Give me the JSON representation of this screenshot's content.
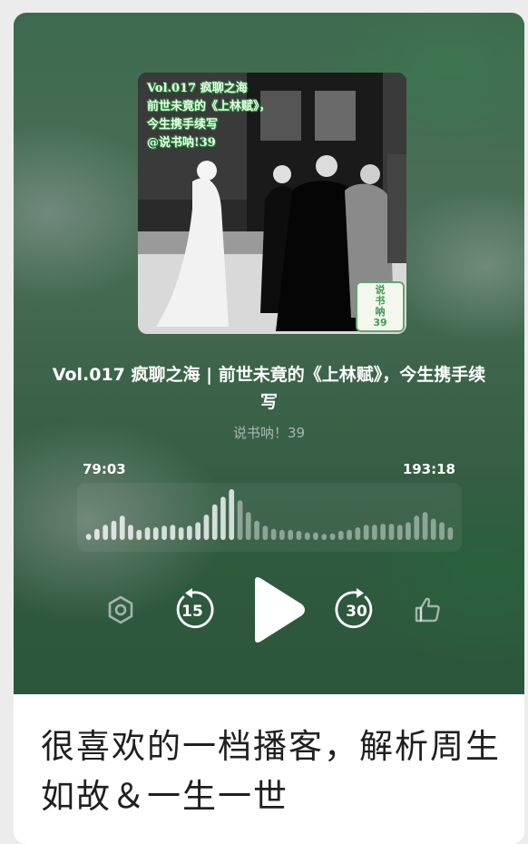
{
  "cover": {
    "overlay_lines": [
      "Vol.017  疯聊之海",
      "前世未竟的《上林赋》，",
      "今生携手续写",
      "@说书呐!39"
    ],
    "badge_lines": [
      "说",
      "书",
      "呐",
      "39"
    ]
  },
  "episode": {
    "title": "Vol.017 疯聊之海 | 前世未竟的《上林赋》，今生携手续写",
    "author": "说书呐！39"
  },
  "player": {
    "current_time": "79:03",
    "total_time": "193:18",
    "progress": 0.409,
    "waveform_levels": [
      0.12,
      0.22,
      0.3,
      0.38,
      0.48,
      0.3,
      0.2,
      0.25,
      0.25,
      0.28,
      0.3,
      0.25,
      0.28,
      0.35,
      0.5,
      0.7,
      0.85,
      1.0,
      0.78,
      0.55,
      0.38,
      0.28,
      0.22,
      0.2,
      0.2,
      0.18,
      0.15,
      0.15,
      0.12,
      0.13,
      0.18,
      0.2,
      0.25,
      0.3,
      0.3,
      0.32,
      0.32,
      0.3,
      0.35,
      0.48,
      0.55,
      0.42,
      0.35,
      0.25
    ],
    "accent_color": "#ffffff"
  },
  "controls": {
    "settings_icon": "hexagon-settings-icon",
    "rewind_label": "15",
    "play_icon": "play-icon",
    "forward_label": "30",
    "like_icon": "thumbs-up-icon"
  },
  "post": {
    "text": "很喜欢的一档播客，解析周生如故＆一生一世"
  }
}
